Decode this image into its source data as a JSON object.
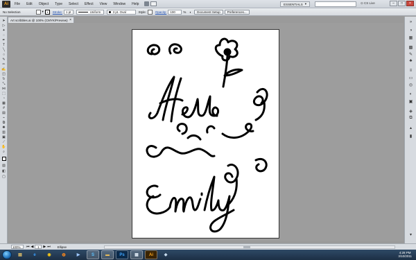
{
  "menubar": {
    "app_logo": "Ai",
    "menus": [
      "File",
      "Edit",
      "Object",
      "Type",
      "Select",
      "Effect",
      "View",
      "Window",
      "Help"
    ],
    "workspace": "ESSENTIALS",
    "cs_live": "CS Live"
  },
  "controlbar": {
    "selection": "No Selection",
    "stroke_label": "Stroke:",
    "stroke_weight": "1 pt",
    "stroke_profile": "Uniform",
    "brush": "3 pt. Oval",
    "style_label": "Style:",
    "opacity_label": "Opacity:",
    "opacity_value": "100",
    "opacity_unit": "%",
    "document_setup": "Document Setup",
    "preferences": "Preferences..."
  },
  "document": {
    "tab_title": "Art scribbles.ai @ 100% (CMYK/Preview)",
    "close_glyph": "×",
    "artwork_text_1": "Hello",
    "artwork_text_2": "Emily"
  },
  "statusbar": {
    "zoom": "100%",
    "page": "1",
    "current_tool": "Ellipse"
  },
  "taskbar": {
    "time": "4:28 PM",
    "date": "3/10/2011",
    "apps": [
      "explorer",
      "ie",
      "chrome",
      "firefox",
      "media",
      "skype",
      "folder",
      "photoshop",
      "bridge",
      "illustrator",
      "other"
    ]
  },
  "colors": {
    "illustrator_orange": "#f7a21b",
    "taskbar_blue": "#1c2f45",
    "canvas_gray": "#9d9d9d"
  }
}
